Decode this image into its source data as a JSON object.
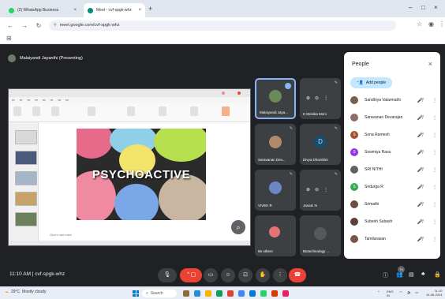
{
  "browser": {
    "tabs": [
      {
        "label": "(2) WhatsApp Business",
        "favicon_color": "#25d366"
      },
      {
        "label": "Meet - cvf-spgk-whz",
        "favicon_color": "#00897b"
      }
    ],
    "new_tab_icon": "+",
    "url": "meet.google.com/cvf-spgk-whz",
    "window_controls": [
      "–",
      "□",
      "×"
    ]
  },
  "meet": {
    "presenter_label": "Malaiyandi Jayanthi (Presenting)",
    "slide_title": "PSYCHOACTIVE",
    "slide_note": "Click to add notes",
    "tiles": [
      {
        "name": "Malaiyandi Jaya...",
        "kind": "photo",
        "active": true
      },
      {
        "name": "K Monika Moni",
        "kind": "photo"
      },
      {
        "name": "Saravanan Dev...",
        "kind": "photo"
      },
      {
        "name": "Divya Dharshini",
        "kind": "letter",
        "letter": "D"
      },
      {
        "name": "VIVEK R",
        "kind": "photo"
      },
      {
        "name": "Janani N",
        "kind": "photo"
      },
      {
        "name": "66 others",
        "kind": "others"
      },
      {
        "name": "Biotechnology ...",
        "kind": "photo"
      }
    ]
  },
  "people": {
    "title": "People",
    "add_label": "Add people",
    "list": [
      {
        "name": "Sandhiya Valarmathi",
        "color": "#7b5e4a"
      },
      {
        "name": "Saravanan Devarajan",
        "color": "#8d6e63"
      },
      {
        "name": "Sona Ramesh",
        "color": "#a0522d",
        "letter": "S"
      },
      {
        "name": "Sowmiya Rasu",
        "color": "#9334e6",
        "letter": "S"
      },
      {
        "name": "SRI NITHI",
        "color": "#5f6368"
      },
      {
        "name": "Sridurga R",
        "color": "#34a853",
        "letter": "S"
      },
      {
        "name": "Srimathi",
        "color": "#6d4c41"
      },
      {
        "name": "Subesh Subash",
        "color": "#5d4037"
      },
      {
        "name": "Tamilarasan",
        "color": "#795548"
      }
    ]
  },
  "bottom": {
    "clock": "11:10 AM",
    "meeting_code": "cvf-spgk-whz",
    "participant_count": "74"
  },
  "taskbar": {
    "weather_temp": "29°C",
    "weather_desc": "Mostly cloudy",
    "search_label": "Search",
    "lang": "ENG",
    "region": "IN",
    "time": "11:10",
    "date": "14-06-2024"
  },
  "colors": {
    "meet_bg": "#202124",
    "end_call": "#ea4335",
    "accent": "#8ab4f8"
  }
}
